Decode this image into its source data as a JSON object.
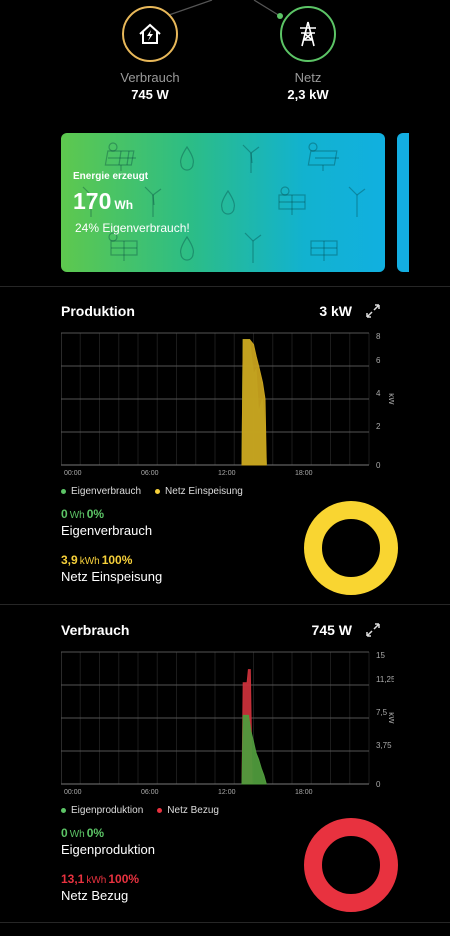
{
  "nodes": {
    "consumption": {
      "label": "Verbrauch",
      "value": "745  W"
    },
    "grid": {
      "label": "Netz",
      "value": "2,3  kW"
    }
  },
  "energy_card": {
    "title": "Energie erzeugt",
    "value": "170",
    "unit": "Wh",
    "subtitle": "24% Eigenverbrauch!"
  },
  "production": {
    "title": "Produktion",
    "power": "3  kW",
    "legend": [
      {
        "label": "Eigenverbrauch",
        "color": "#5cc466"
      },
      {
        "label": "Netz Einspeisung",
        "color": "#f6d03a"
      }
    ],
    "stat1": {
      "value": "0",
      "unit": "Wh",
      "percent": "0%",
      "label": "Eigenverbrauch",
      "color": "#5cc466"
    },
    "stat2": {
      "value": "3,9",
      "unit": "kWh",
      "percent": "100%",
      "label": "Netz Einspeisung",
      "color": "#f6d03a"
    },
    "ring_color": "#f9d531"
  },
  "consumption": {
    "title": "Verbrauch",
    "power": "745  W",
    "legend": [
      {
        "label": "Eigenproduktion",
        "color": "#5cc466"
      },
      {
        "label": "Netz Bezug",
        "color": "#e8323f"
      }
    ],
    "stat1": {
      "value": "0",
      "unit": "Wh",
      "percent": "0%",
      "label": "Eigenproduktion",
      "color": "#5cc466"
    },
    "stat2": {
      "value": "13,1",
      "unit": "kWh",
      "percent": "100%",
      "label": "Netz Bezug",
      "color": "#e8323f"
    },
    "ring_color": "#e8323f"
  },
  "chart_data": [
    {
      "type": "area",
      "title": "",
      "xlabel": "",
      "ylabel": "kW",
      "x_ticks": [
        "00:00",
        "06:00",
        "12:00",
        "18:00"
      ],
      "y_ticks": [
        "0",
        "2",
        "4",
        "6",
        "8"
      ],
      "ylim": [
        0,
        8
      ],
      "xlim_hours": [
        0,
        24
      ],
      "y_axis_side": "right",
      "grid": true,
      "series": [
        {
          "name": "Eigenverbrauch",
          "color": "#4f9a3c",
          "x": [
            14.1,
            14.2,
            14.4,
            14.7,
            15.0,
            15.2,
            15.4,
            15.7,
            15.9,
            16.0
          ],
          "y": [
            0,
            7.6,
            7.6,
            7.6,
            5.5,
            5.8,
            3.2,
            4.0,
            2.0,
            0
          ]
        },
        {
          "name": "Netz Einspeisung",
          "color": "#c8a21e",
          "x": [
            14.1,
            14.2,
            14.4,
            14.7,
            15.0,
            15.2,
            15.4,
            15.7,
            15.9,
            16.0
          ],
          "y": [
            0,
            7.6,
            7.6,
            7.6,
            7.3,
            6.6,
            6.0,
            5.0,
            4.0,
            0
          ]
        }
      ]
    },
    {
      "type": "area",
      "title": "",
      "xlabel": "",
      "ylabel": "kW",
      "x_ticks": [
        "00:00",
        "06:00",
        "12:00",
        "18:00"
      ],
      "y_ticks": [
        "0",
        "3,75",
        "7,5",
        "11,25",
        "15"
      ],
      "ylim": [
        0,
        15
      ],
      "xlim_hours": [
        0,
        24
      ],
      "y_axis_side": "right",
      "grid": true,
      "series": [
        {
          "name": "Netz Bezug",
          "color": "#c8303a",
          "x": [
            14.1,
            14.2,
            14.5,
            14.6,
            14.75,
            14.9
          ],
          "y": [
            0,
            11.5,
            11.5,
            13.0,
            13.0,
            0
          ]
        },
        {
          "name": "Eigenproduktion",
          "color": "#4f9a3c",
          "x": [
            14.1,
            14.2,
            14.6,
            14.8,
            15.0,
            15.2,
            15.4,
            15.6,
            15.8,
            16.0
          ],
          "y": [
            0,
            7.8,
            7.8,
            6.0,
            4.8,
            3.5,
            2.8,
            1.8,
            1.0,
            0
          ]
        }
      ]
    }
  ]
}
